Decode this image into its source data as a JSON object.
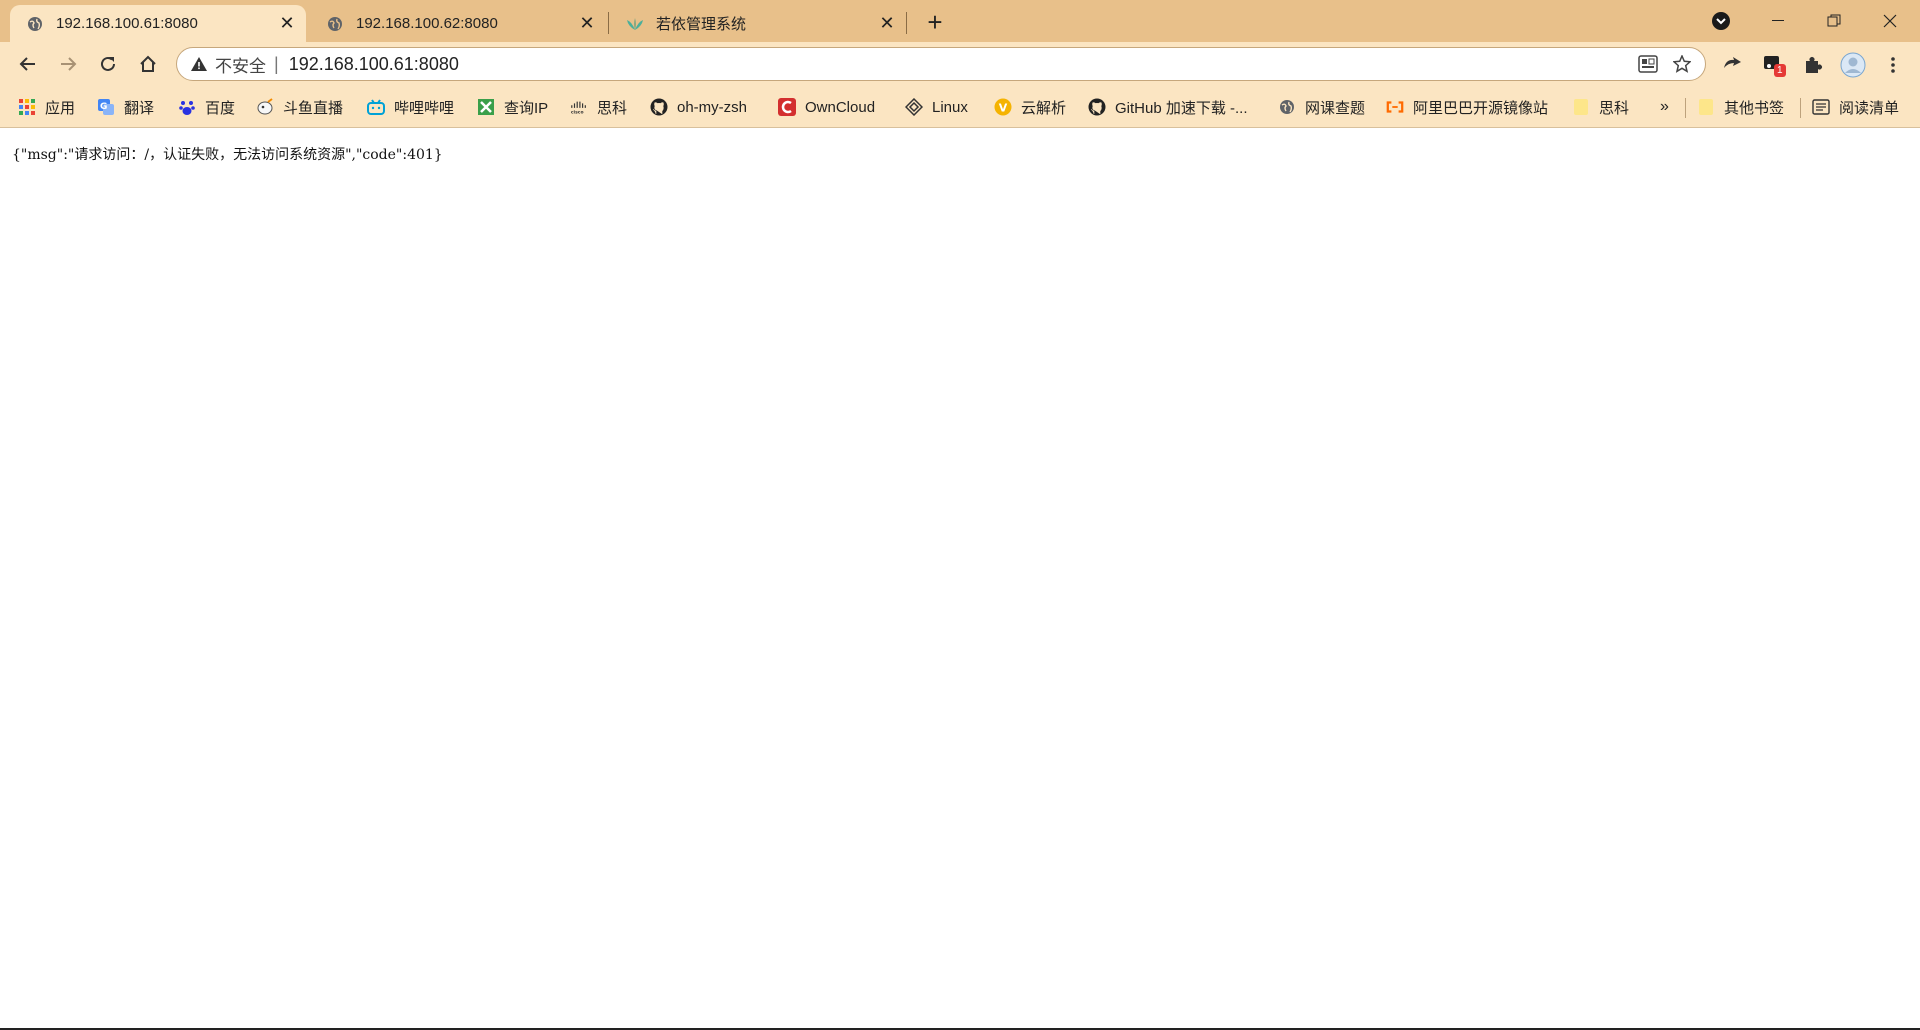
{
  "tabs": [
    {
      "title": "192.168.100.61:8080",
      "icon": "globe-icon",
      "active": true
    },
    {
      "title": "192.168.100.62:8080",
      "icon": "globe-icon",
      "active": false
    },
    {
      "title": "若依管理系统",
      "icon": "ruoyi-leaf-icon",
      "active": false
    }
  ],
  "newtab_label": "+",
  "omnibox": {
    "security_label": "不安全",
    "url": "192.168.100.61:8080"
  },
  "extensions": [
    "sync-icon",
    "extension-badge-icon",
    "puzzle-icon",
    "profile-avatar-icon",
    "menu-kebab-icon"
  ],
  "extension_badge_count": "1",
  "bookmarks": [
    {
      "label": "应用",
      "icon": "apps-grid-icon"
    },
    {
      "label": "翻译",
      "icon": "translate-icon"
    },
    {
      "label": "百度",
      "icon": "baidu-paw-icon"
    },
    {
      "label": "斗鱼直播",
      "icon": "douyu-icon"
    },
    {
      "label": "哔哩哔哩",
      "icon": "bilibili-icon"
    },
    {
      "label": "查询IP",
      "icon": "ip-lookup-icon"
    },
    {
      "label": "思科",
      "icon": "cisco-icon"
    },
    {
      "label": "oh-my-zsh",
      "icon": "github-icon"
    },
    {
      "label": "OwnCloud",
      "icon": "owncloud-icon"
    },
    {
      "label": "Linux",
      "icon": "linux-icon"
    },
    {
      "label": "云解析",
      "icon": "dns-v-icon"
    },
    {
      "label": "GitHub 加速下载 -...",
      "icon": "github-icon"
    },
    {
      "label": "网课查题",
      "icon": "globe-icon"
    },
    {
      "label": "阿里巴巴开源镜像站",
      "icon": "aliyun-icon"
    },
    {
      "label": "思科",
      "icon": "folder-icon"
    }
  ],
  "bookmarks_overflow": "»",
  "other_bookmarks": {
    "label": "其他书签",
    "icon": "folder-icon"
  },
  "reading_list": {
    "label": "阅读清单",
    "icon": "reading-list-icon"
  },
  "page": {
    "body_text": "{\"msg\":\"请求访问：/，认证失败，无法访问系统资源\",\"code\":401}"
  },
  "colors": {
    "tabstrip_bg": "#e8c08a",
    "toolbar_bg": "#fbe5c2",
    "badge_red": "#e53935"
  }
}
